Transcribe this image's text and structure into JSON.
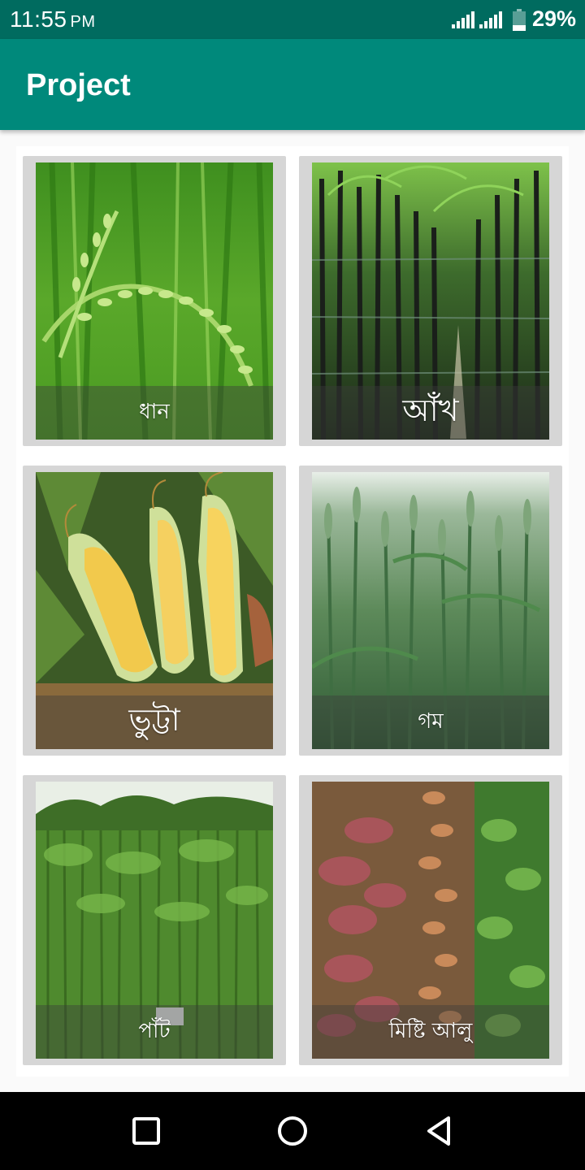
{
  "status_bar": {
    "time": "11:55",
    "ampm": "PM",
    "battery_percent": "29%",
    "battery_level": 0.29,
    "icons": [
      "signal-icon",
      "signal-icon",
      "battery-icon"
    ]
  },
  "app_bar": {
    "title": "Project"
  },
  "crops": [
    {
      "label": "ধান",
      "image": "rice-paddy-photo"
    },
    {
      "label": "আঁখ",
      "image": "sugarcane-field-photo"
    },
    {
      "label": "ভুট্টা",
      "image": "corn-cobs-photo"
    },
    {
      "label": "গম",
      "image": "wheat-field-photo"
    },
    {
      "label": "পাঁট",
      "image": "jute-field-photo"
    },
    {
      "label": "মিষ্টি আলু",
      "image": "sweet-potato-photo"
    }
  ],
  "nav_bar": {
    "icons": [
      "recents-square-icon",
      "home-circle-icon",
      "back-triangle-icon"
    ]
  },
  "colors": {
    "status_bar": "#006b5f",
    "app_bar": "#00897b",
    "tile_frame": "#d6d6d6",
    "nav_bar": "#000000"
  }
}
